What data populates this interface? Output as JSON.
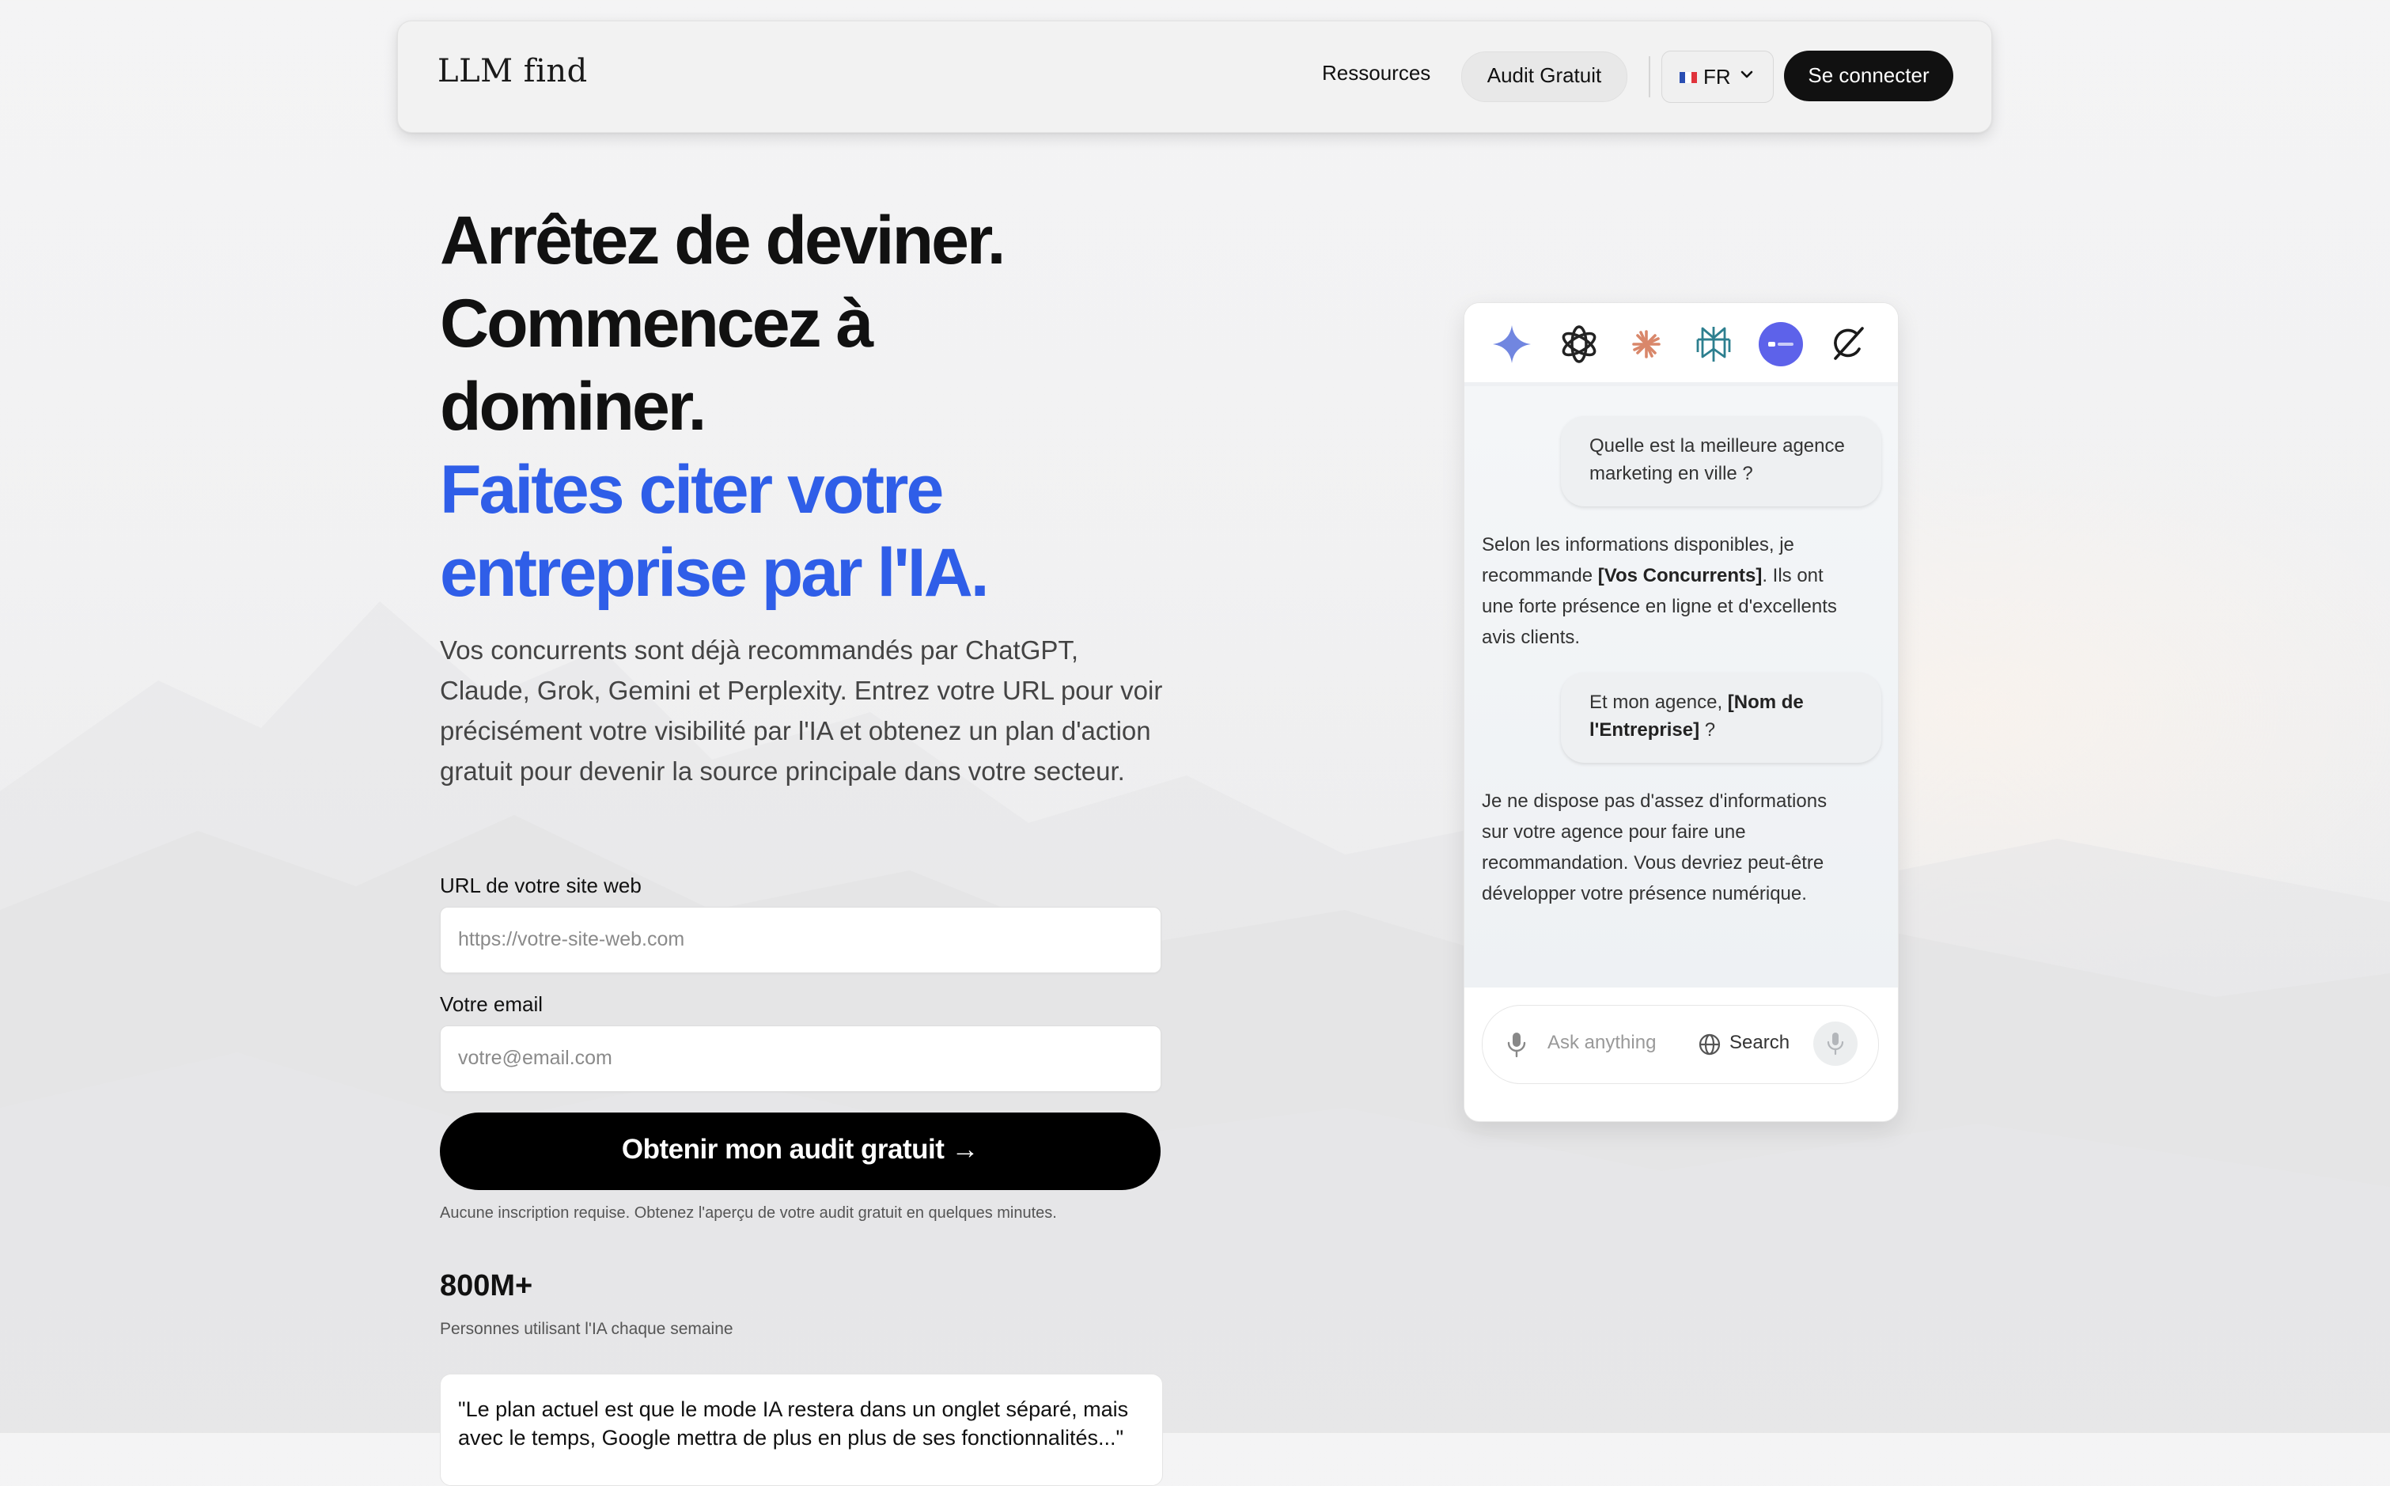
{
  "navbar": {
    "logo": "LLM find",
    "resources": "Ressources",
    "audit": "Audit Gratuit",
    "language": "FR",
    "login": "Se connecter"
  },
  "hero": {
    "title_line1": "Arrêtez de deviner.",
    "title_line2": "Commencez à",
    "title_line3": "dominer.",
    "title_blue_line1": "Faites citer votre",
    "title_blue_line2": "entreprise par l'IA.",
    "subtitle": "Vos concurrents sont déjà recommandés par ChatGPT, Claude, Grok, Gemini et Perplexity. Entrez votre URL pour voir précisément votre visibilité par l'IA et obtenez un plan d'action gratuit pour devenir la source principale dans votre secteur.",
    "accent_color": "#2f5ee8"
  },
  "form": {
    "url_label": "URL de votre site web",
    "url_placeholder": "https://votre-site-web.com",
    "email_label": "Votre email",
    "email_placeholder": "votre@email.com",
    "submit": "Obtenir mon audit gratuit →",
    "note": "Aucune inscription requise. Obtenez l'aperçu de votre audit gratuit en quelques minutes."
  },
  "stats": {
    "value": "800M+",
    "label": "Personnes utilisant l'IA chaque semaine"
  },
  "quote": {
    "text": "\"Le plan actuel est que le mode IA restera dans un onglet séparé, mais avec le temps, Google mettra de plus en plus de ses fonctionnalités...\""
  },
  "chat": {
    "icons": [
      "gemini-icon",
      "openai-icon",
      "claude-icon",
      "perplexity-icon",
      "assistant-icon",
      "grok-icon"
    ],
    "q1": "Quelle est la meilleure agence marketing en ville ?",
    "a1_pre": "Selon les informations disponibles, je recommande ",
    "a1_bold": "[Vos Concurrents]",
    "a1_post": ". Ils ont une forte présence en ligne et d'excellents avis clients.",
    "q2_pre": "Et mon agence, ",
    "q2_bold": "[Nom de l'Entreprise]",
    "q2_post": " ?",
    "a2": "Je ne dispose pas d'assez d'informations sur votre agence pour faire une recommandation. Vous devriez peut-être développer votre présence numérique.",
    "input_placeholder": "Ask anything",
    "search_label": "Search"
  }
}
